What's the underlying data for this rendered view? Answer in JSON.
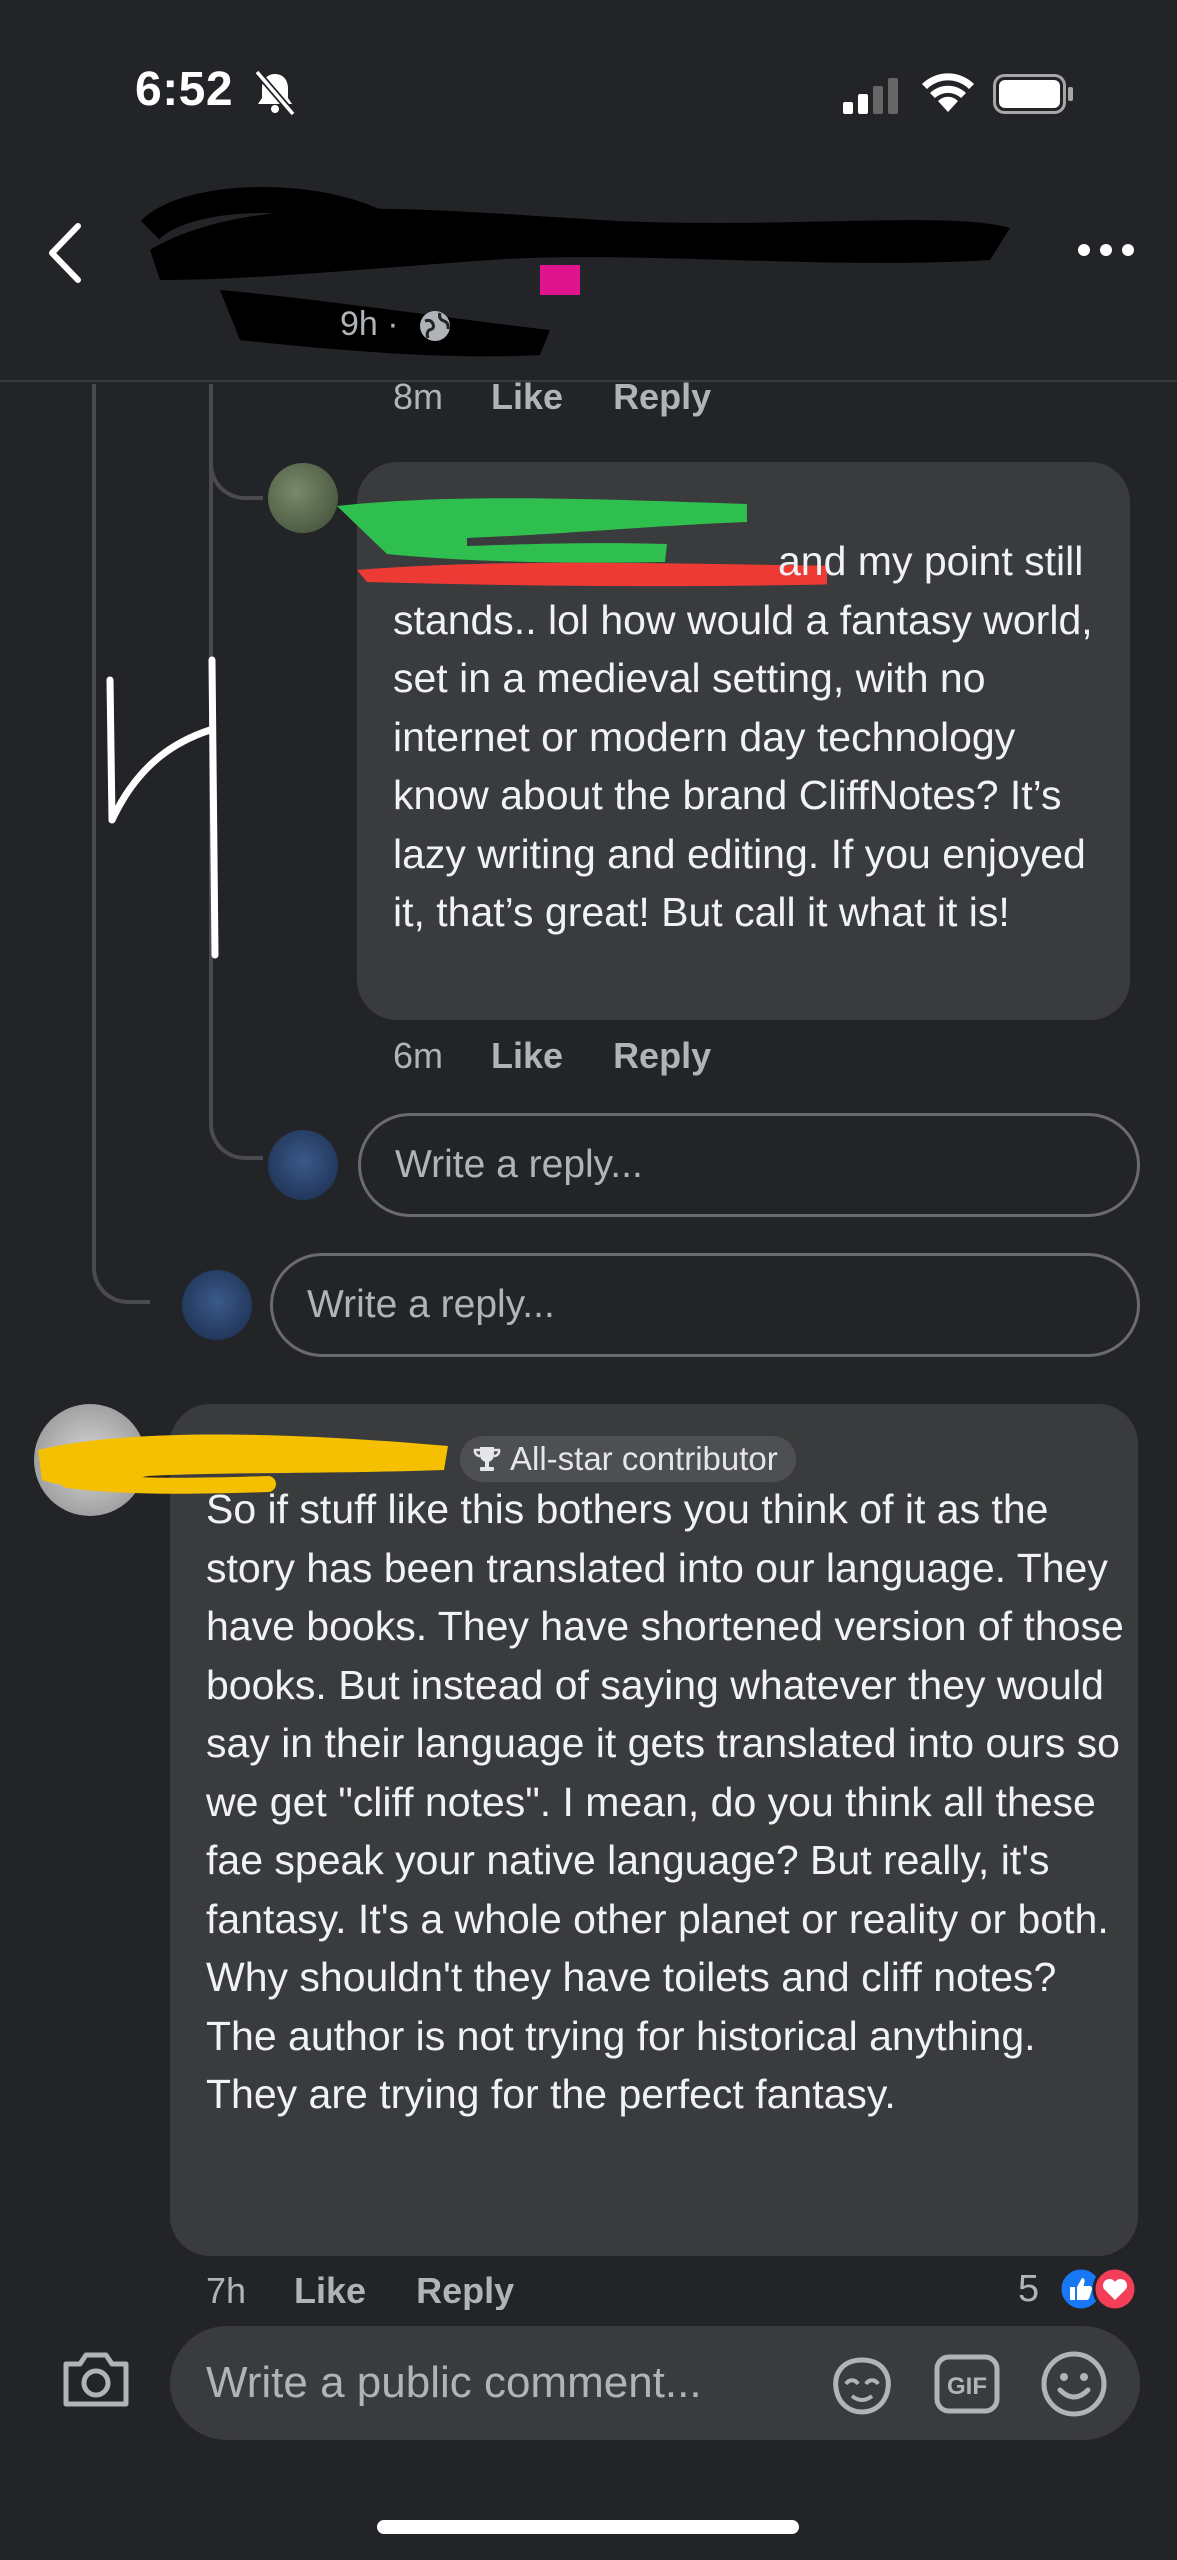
{
  "status_bar": {
    "time": "6:52"
  },
  "header": {
    "meta_text": "9h ·"
  },
  "reply1": {
    "time": "8m",
    "like": "Like",
    "reply": "Reply"
  },
  "reply2": {
    "text": "and my point still stands.. lol how would a fantasy world, set in a medieval setting, with no internet or modern day technology know about the brand CliffNotes? It’s lazy writing and editing. If you enjoyed it, that’s great! But call it what it is!",
    "time": "6m",
    "like": "Like",
    "reply": "Reply"
  },
  "reply_inputs": {
    "nested_placeholder": "Write a reply...",
    "thread_placeholder": "Write a reply..."
  },
  "comment": {
    "badge": "All-star contributor",
    "text": "So if stuff like this bothers you think of it as the story has been translated into our language.   They have books.  They have shortened version of those books.  But instead of saying whatever they would say in their language it gets translated into ours so we get \"cliff notes\".  I mean, do you think all these fae speak your native language?  But really, it's fantasy.  It's a whole other planet or reality or both.  Why shouldn't they have toilets and cliff notes?  The author is not trying for historical anything.  They are trying for the perfect fantasy.",
    "time": "7h",
    "like": "Like",
    "reply": "Reply",
    "reaction_count": "5"
  },
  "composer": {
    "placeholder": "Write a public comment..."
  },
  "colors": {
    "background": "#232427",
    "bubble": "#3a3b3c",
    "like_blue": "#1877f2",
    "love_red": "#f33e58"
  }
}
